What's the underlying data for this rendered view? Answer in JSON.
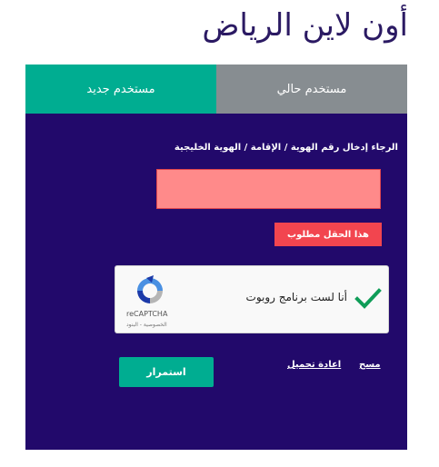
{
  "header": {
    "title": "أون لاين الرياض"
  },
  "tabs": {
    "new_user": "مستخدم جديد",
    "current_user": "مستخدم حالي"
  },
  "form": {
    "instruction": "الرجاء إدخال رقم الهوية / الإقامة / الهوية الخليجية",
    "id_value": "",
    "error": "هذا الحقل مطلوب"
  },
  "captcha": {
    "label": "أنا لست برنامج روبوت",
    "brand": "reCAPTCHA",
    "links": "الخصوصية - البنود"
  },
  "actions": {
    "clear": "مسح",
    "reload": "اعادة تحميل",
    "continue": "استمرار"
  },
  "colors": {
    "card_bg": "#22096b",
    "tab_active": "#00ad91",
    "tab_inactive": "#878d91",
    "error": "#f2454f",
    "input_error_bg": "#ff8a8a",
    "check": "#0f9d58"
  }
}
